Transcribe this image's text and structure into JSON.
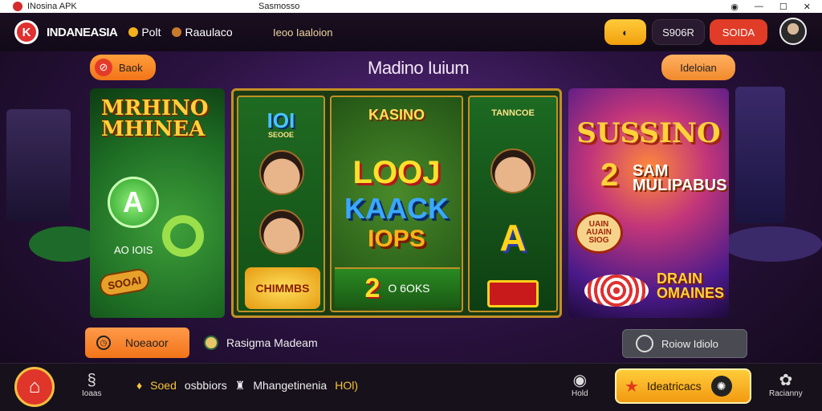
{
  "titlebar": {
    "app_title": "INosina APK",
    "center_title": "Sasmosso",
    "controls": [
      "wifi-icon",
      "minimize-icon",
      "maximize-icon",
      "close-icon"
    ]
  },
  "header": {
    "logo_letter": "K",
    "brand": "INDANEASIA",
    "nav": [
      {
        "label": "Polt",
        "icon": "coin-icon",
        "color": "#f2b11a"
      },
      {
        "label": "Raaulaco",
        "icon": "shield-icon",
        "color": "#c87a2a"
      }
    ],
    "link": "Ieoo Iaaloion",
    "wallet_icon": "wallet-icon",
    "coins_label": "S906R",
    "deposit_label": "SOIDA"
  },
  "toolbar": {
    "back_label": "Baok",
    "title": "Madino Iuium",
    "promo_label": "Ideloian"
  },
  "cards": {
    "left": {
      "title": "MRHINO MHINEA",
      "chip_letter": "A",
      "label": "AO IOIS",
      "tag": "SOOAI"
    },
    "center": {
      "reel1": {
        "title": "IOI",
        "sub": "SEOOE",
        "badge": "CHIMMBS"
      },
      "reel2": {
        "title": "KASINO",
        "line1": "LOOJ",
        "line2": "KAACK",
        "line3": "IOPS",
        "bar_num": "2",
        "bar_text": "O 6OKS"
      },
      "reel3": {
        "title": "TANNCOE",
        "letter": "A"
      }
    },
    "right": {
      "title": "SUSSINO",
      "num": "2",
      "line": "SAM MULIPABUS",
      "badge": "UAIN AUAIN SIOG",
      "bottom": "DRAIN OMAINES"
    }
  },
  "actions": {
    "primary_label": "Noeaoor",
    "info_text": "Rasigma Madeam",
    "secondary_label": "Roiow Idiolo"
  },
  "bottom": {
    "home_icon": "home-icon",
    "tab1_label": "Ioaas",
    "stats": [
      {
        "text": "Soed",
        "highlight": true
      },
      {
        "text": "osbbiors",
        "highlight": false
      },
      {
        "text": "Mhangetinenia",
        "highlight": false
      },
      {
        "text": "HOl)",
        "highlight": false
      }
    ],
    "tab2_label": "Hold",
    "cta_label": "Ideatricacs",
    "tab3_label": "Racianny"
  }
}
